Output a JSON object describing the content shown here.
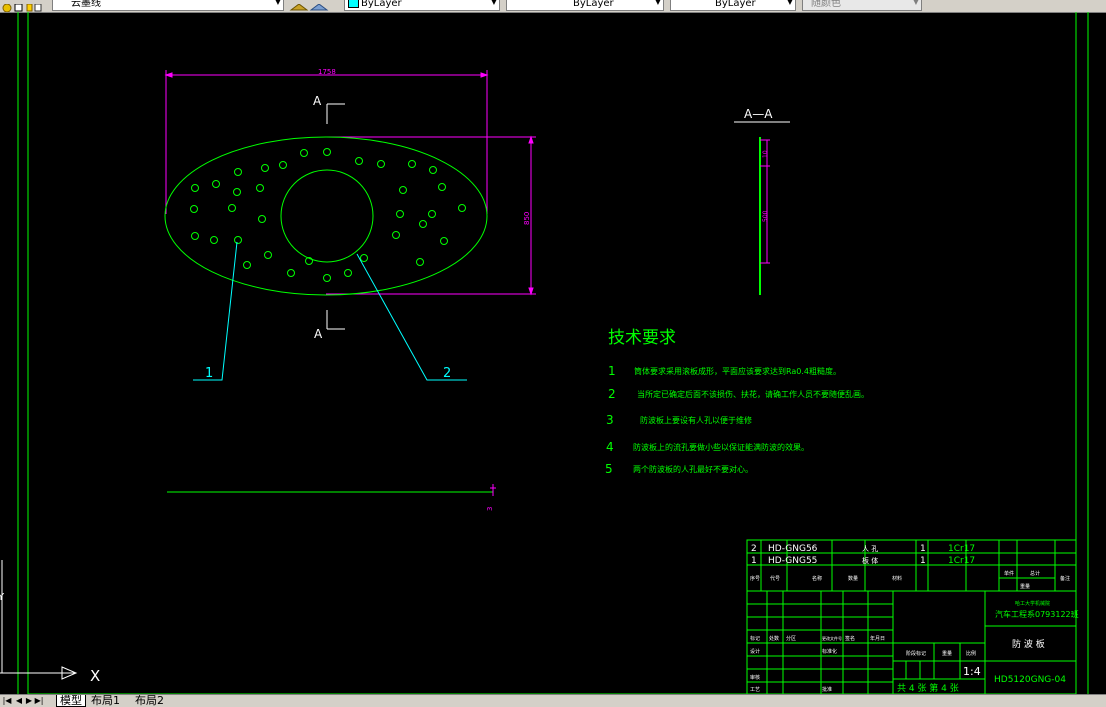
{
  "toolbar": {
    "layer_name": "云墨线",
    "color_value": "ByLayer",
    "linetype_value": "ByLayer",
    "lineweight_value": "ByLayer",
    "plotstyle_value": "随颜色"
  },
  "drawing": {
    "dim_width": "1758",
    "dim_height": "850",
    "dim_thickness_label": "3",
    "section_mark_top": "A",
    "section_mark_bottom": "A",
    "section_title": "A—A",
    "section_dim_1": "10",
    "section_dim_2": "500",
    "leader_1": "1",
    "leader_2": "2",
    "tech_title": "技术要求",
    "tech_reqs": [
      {
        "num": "1",
        "text": "筒体要求采用滚板成形，平面应该要求达到Ra0.4粗糙度。"
      },
      {
        "num": "2",
        "text": "当所定已确定后面不该损伤、扶花，请确工作人员不要随便乱画。"
      },
      {
        "num": "3",
        "text": "防波板上要设有人孔以便于维修"
      },
      {
        "num": "4",
        "text": "防波板上的流孔要做小些以保证能满防波的效果。"
      },
      {
        "num": "5",
        "text": "两个防波板的人孔最好不要对心。"
      }
    ],
    "ucs_x": "X",
    "ucs_y": "Y"
  },
  "titleblock": {
    "parts": [
      {
        "no": "2",
        "code": "HD-GNG56",
        "name": "人 孔",
        "qty": "1",
        "material": "1Cr17"
      },
      {
        "no": "1",
        "code": "HD-GNG55",
        "name": "板 体",
        "qty": "1",
        "material": "1Cr17"
      }
    ],
    "header": {
      "no": "序号",
      "code": "代号",
      "name": "名称",
      "qty": "数量",
      "material": "材料",
      "unit_weight": "单件",
      "total_weight": "总计",
      "weight": "重量",
      "note": "备注"
    },
    "school": "哈工大学机械院",
    "student": "汽车工程系0793122班",
    "drawing_name": "防 波 板",
    "scale": "1:4",
    "sheet_info": "共 4 张   第 4 张",
    "drawing_no": "HD5120GNG-04",
    "stage_label": "阶段标记",
    "weight_label": "重量",
    "scale_label": "比例",
    "row_labels": {
      "mark": "标记",
      "count": "处数",
      "zone": "分区",
      "doc": "更改文件号",
      "sign": "签名",
      "date": "年月日",
      "design": "设计",
      "std": "标准化",
      "review": "审核",
      "craft": "工艺",
      "approve": "批准"
    }
  },
  "tabs": {
    "model": "模型",
    "layout1": "布局1",
    "layout2": "布局2"
  }
}
